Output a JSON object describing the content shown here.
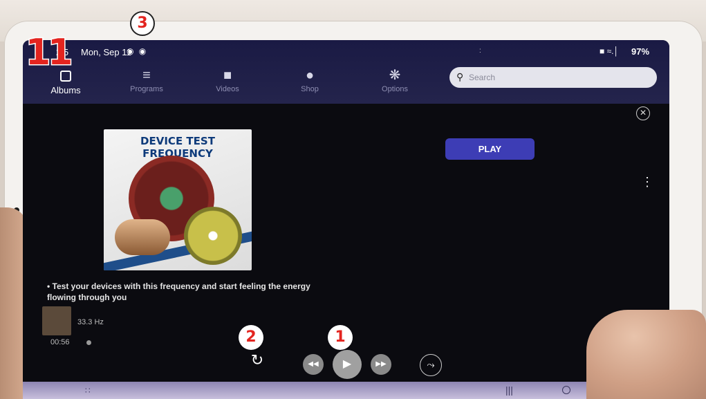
{
  "overlay": {
    "step_number": "11",
    "callouts": [
      "1",
      "2",
      "3"
    ]
  },
  "status_bar": {
    "time": "2:5",
    "date": "Mon, Sep 11",
    "left_icons": "◉ ◉",
    "center_indicator": ":",
    "right_icons": "■ ≈.│",
    "battery": "97%"
  },
  "tabs": [
    {
      "label": "Albums",
      "icon": "albums-icon",
      "active": true
    },
    {
      "label": "Programs",
      "icon": "list-icon"
    },
    {
      "label": "Videos",
      "icon": "video-camera-icon"
    },
    {
      "label": "Shop",
      "icon": "compass-icon"
    },
    {
      "label": "Options",
      "icon": "gear-icon"
    }
  ],
  "search": {
    "placeholder": "Search"
  },
  "album": {
    "title": "DEVICE TEST FREQUENCY",
    "description": "• Test your devices with this frequency and start feeling the energy flowing through you",
    "play_label": "PLAY"
  },
  "now_playing": {
    "frequency": "33.3 Hz",
    "elapsed": "00:56"
  },
  "controls": {
    "repeat_icon": "↻",
    "rewind_icon": "◀◀",
    "play_icon": "▶",
    "forward_icon": "▶▶",
    "shuffle_icon": "⤳"
  },
  "nav_bar": {
    "apps_icon": "∷",
    "recent_icon": "|||"
  },
  "colors": {
    "header_bg": "#1a1a44",
    "play_button": "#3d3db5",
    "callout_red": "#e3241f"
  }
}
